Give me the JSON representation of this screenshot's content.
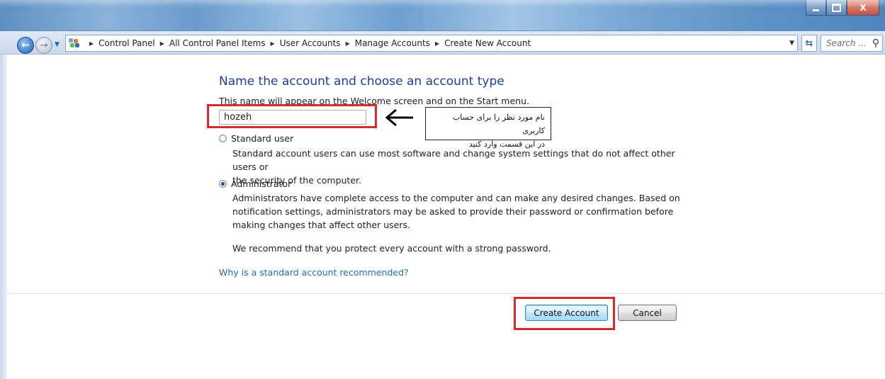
{
  "window": {
    "minimize_glyph": "_",
    "maximize_glyph": "□",
    "close_glyph": "X"
  },
  "address_bar": {
    "breadcrumbs": [
      {
        "label": "Control Panel"
      },
      {
        "label": "All Control Panel Items"
      },
      {
        "label": "User Accounts"
      },
      {
        "label": "Manage Accounts"
      },
      {
        "label": "Create New Account"
      }
    ],
    "search_placeholder": "Search ..."
  },
  "main": {
    "heading": "Name the account and choose an account type",
    "subtext": "This name will appear on the Welcome screen and on the Start menu.",
    "account_name_value": "hozeh",
    "annotation_line1": "نام مورد نظر را برای حساب کاربری",
    "annotation_line2": "در این قسمت وارد کنید",
    "options": [
      {
        "label": "Standard user",
        "checked": false,
        "description_lines": [
          "Standard account users can use most software and change system settings that do not affect other users or",
          "the security of the computer."
        ]
      },
      {
        "label": "Administrator",
        "checked": true,
        "description_lines": [
          "Administrators have complete access to the computer and can make any desired changes. Based on",
          "notification settings, administrators may be asked to provide their password or confirmation before",
          "making changes that affect other users."
        ]
      }
    ],
    "recommendation": "We recommend that you protect every account with a strong password.",
    "help_link": "Why is a standard account recommended?"
  },
  "buttons": {
    "create_label": "Create Account",
    "cancel_label": "Cancel"
  },
  "colors": {
    "highlight": "#d12b2b",
    "heading": "#1f3e9a",
    "link": "#1f6db8"
  }
}
